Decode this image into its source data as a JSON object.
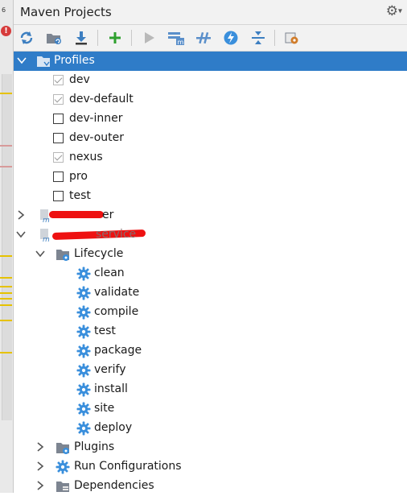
{
  "window": {
    "title": "Maven Projects"
  },
  "gutter": {
    "tab_number": "6",
    "error_mark": "!"
  },
  "toolbar": {
    "buttons": [
      {
        "name": "reimport-icon",
        "color": "#3d7fc1"
      },
      {
        "name": "generate-sources-icon",
        "color": "#3d7fc1"
      },
      {
        "name": "download-icon",
        "color": "#3d7fc1"
      },
      {
        "name": "add-icon",
        "color": "#2ea02e"
      },
      {
        "name": "run-icon",
        "color": "#b9b9b9"
      },
      {
        "name": "execute-goal-icon",
        "color": "#5a8fca"
      },
      {
        "name": "toggle-offline-icon",
        "color": "#5a8fca"
      },
      {
        "name": "skip-tests-icon",
        "color": "#3d7fc1"
      },
      {
        "name": "collapse-all-icon",
        "color": "#3d7fc1"
      },
      {
        "name": "settings-icon",
        "color": "#d07c2a"
      }
    ]
  },
  "tree": {
    "profiles": {
      "label": "Profiles",
      "items": [
        {
          "label": "dev",
          "checked": true
        },
        {
          "label": "dev-default",
          "checked": true
        },
        {
          "label": "dev-inner",
          "checked": false
        },
        {
          "label": "dev-outer",
          "checked": false
        },
        {
          "label": "nexus",
          "checked": true
        },
        {
          "label": "pro",
          "checked": false
        },
        {
          "label": "test",
          "checked": false
        }
      ]
    },
    "project1": {
      "label": "er",
      "expanded": false
    },
    "project2": {
      "label": "service",
      "expanded": true,
      "lifecycle": {
        "label": "Lifecycle",
        "goals": [
          "clean",
          "validate",
          "compile",
          "test",
          "package",
          "verify",
          "install",
          "site",
          "deploy"
        ]
      },
      "plugins": "Plugins",
      "run_configurations": "Run Configurations",
      "dependencies": "Dependencies"
    }
  },
  "colors": {
    "selection": "#2f7cc8",
    "gear_blue": "#3a8fdc",
    "folder_gray": "#7d8591",
    "redaction": "#ee1111"
  }
}
